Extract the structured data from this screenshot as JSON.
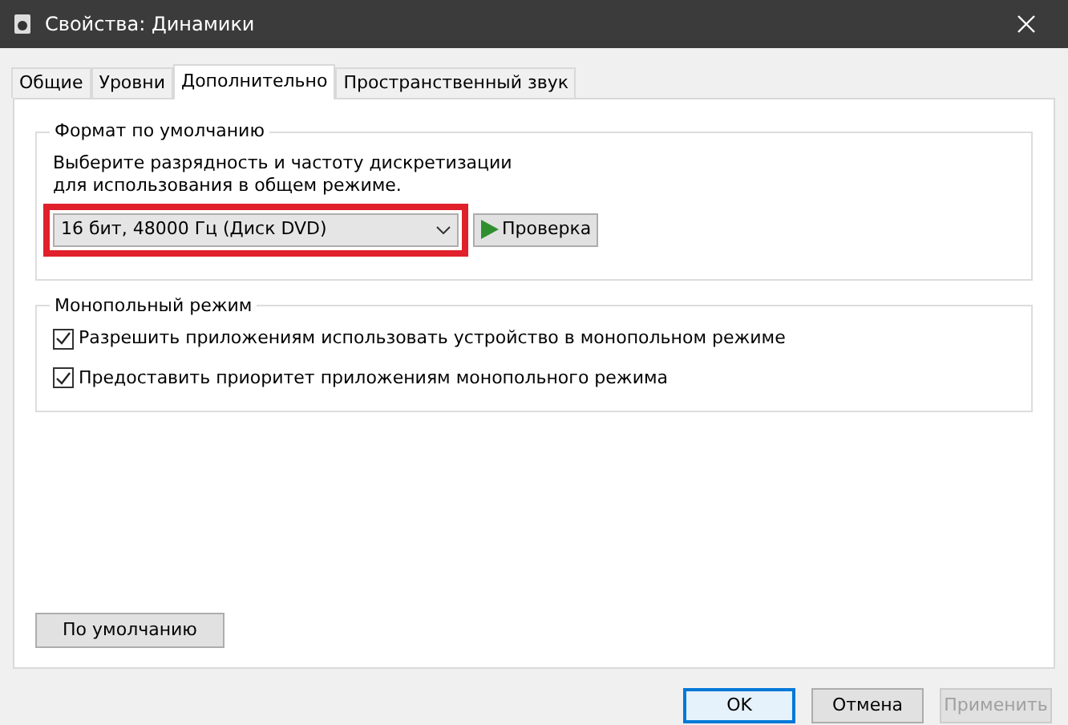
{
  "window": {
    "title": "Свойства: Динамики"
  },
  "tabs": [
    {
      "label": "Общие",
      "selected": false
    },
    {
      "label": "Уровни",
      "selected": false
    },
    {
      "label": "Дополнительно",
      "selected": true
    },
    {
      "label": "Пространственный звук",
      "selected": false
    }
  ],
  "default_format": {
    "title": "Формат по умолчанию",
    "description": "Выберите разрядность и частоту дискретизации для использования в общем режиме.",
    "format_value": "16 бит, 48000 Гц (Диск DVD)",
    "highlighted": true,
    "test_button": "Проверка"
  },
  "exclusive_mode": {
    "title": "Монопольный режим",
    "options": [
      {
        "label": "Разрешить приложениям использовать устройство в монопольном режиме",
        "checked": true
      },
      {
        "label": "Предоставить приоритет приложениям монопольного режима",
        "checked": true
      }
    ]
  },
  "restore_button": "По умолчанию",
  "buttons": [
    {
      "label": "OK",
      "kind": "default",
      "disabled": false
    },
    {
      "label": "Отмена",
      "kind": "normal",
      "disabled": false
    },
    {
      "label": "Применить",
      "kind": "normal",
      "disabled": true
    }
  ]
}
